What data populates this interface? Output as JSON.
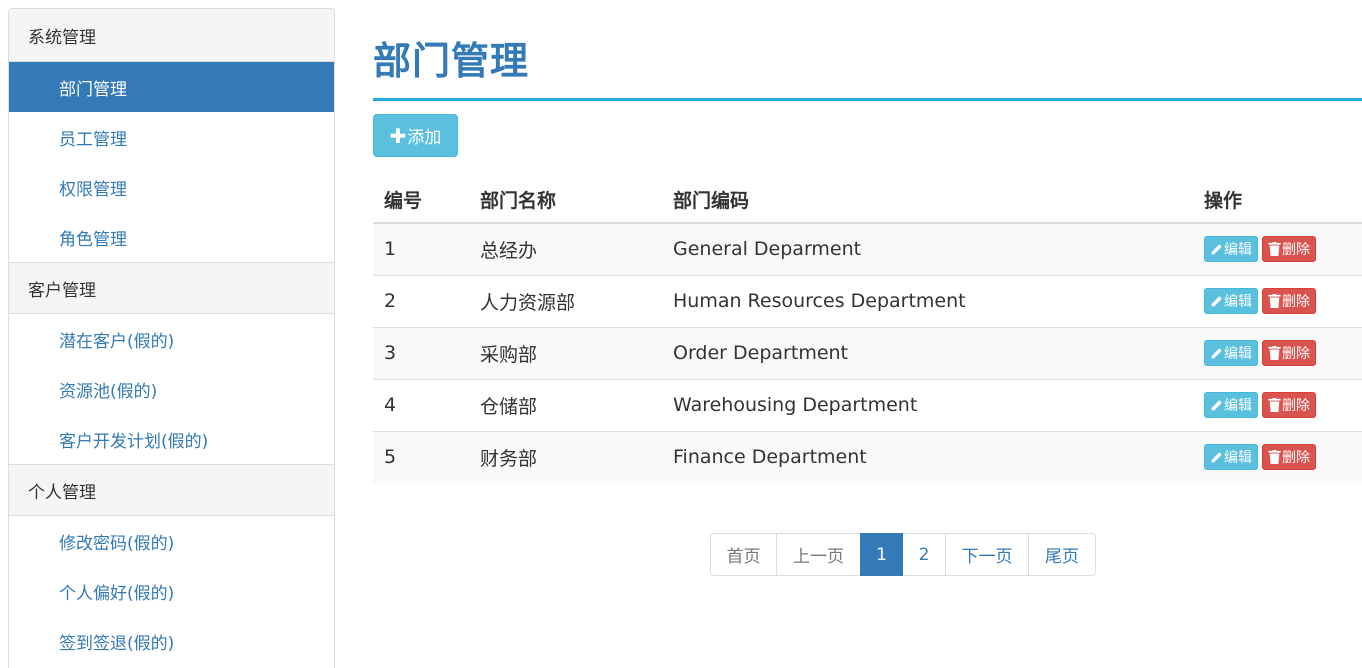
{
  "sidebar": {
    "groups": [
      {
        "header": "系统管理",
        "items": [
          {
            "label": "部门管理"
          },
          {
            "label": "员工管理"
          },
          {
            "label": "权限管理"
          },
          {
            "label": "角色管理"
          }
        ]
      },
      {
        "header": "客户管理",
        "items": [
          {
            "label": "潜在客户(假的)"
          },
          {
            "label": "资源池(假的)"
          },
          {
            "label": "客户开发计划(假的)"
          }
        ]
      },
      {
        "header": "个人管理",
        "items": [
          {
            "label": "修改密码(假的)"
          },
          {
            "label": "个人偏好(假的)"
          },
          {
            "label": "签到签退(假的)"
          }
        ]
      }
    ]
  },
  "main": {
    "title": "部门管理",
    "add_label": "添加",
    "table": {
      "headers": {
        "id": "编号",
        "name": "部门名称",
        "code": "部门编码",
        "ops": "操作"
      },
      "rows": [
        {
          "id": "1",
          "name": "总经办",
          "code": "General Deparment"
        },
        {
          "id": "2",
          "name": "人力资源部",
          "code": "Human Resources Department"
        },
        {
          "id": "3",
          "name": "采购部",
          "code": "Order Department"
        },
        {
          "id": "4",
          "name": "仓储部",
          "code": "Warehousing Department"
        },
        {
          "id": "5",
          "name": "财务部",
          "code": "Finance Department"
        }
      ],
      "edit_label": "编辑",
      "delete_label": "删除"
    },
    "pagination": {
      "first": "首页",
      "prev": "上一页",
      "page1": "1",
      "page2": "2",
      "next": "下一页",
      "last": "尾页"
    }
  },
  "colors": {
    "primary": "#337ab7",
    "info": "#5bc0de",
    "danger": "#d9534f",
    "title_rule": "#23a8e0"
  }
}
